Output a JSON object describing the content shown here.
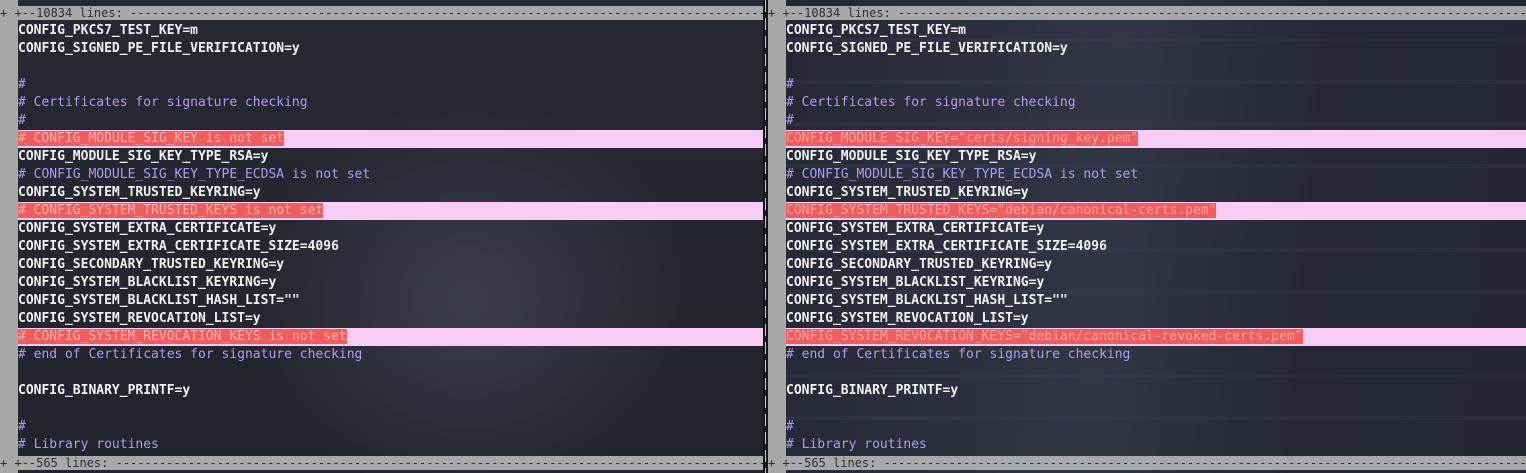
{
  "left_pane": {
    "fold_top": "+ +--10834 lines: ------------------------------------------------------------------------------------------",
    "fold_bottom": "+ +--565 lines: --------------------------------------------------------------------------------------------",
    "lines": [
      {
        "text": "CONFIG_PKCS7_TEST_KEY=m",
        "kind": "code"
      },
      {
        "text": "CONFIG_SIGNED_PE_FILE_VERIFICATION=y",
        "kind": "code"
      },
      {
        "text": "",
        "kind": "code"
      },
      {
        "text": "#",
        "kind": "comment"
      },
      {
        "text": "# Certificates for signature checking",
        "kind": "comment"
      },
      {
        "text": "#",
        "kind": "comment"
      },
      {
        "text": "# CONFIG_MODULE_SIG_KEY is not set",
        "kind": "diff"
      },
      {
        "text": "CONFIG_MODULE_SIG_KEY_TYPE_RSA=y",
        "kind": "code"
      },
      {
        "text": "# CONFIG_MODULE_SIG_KEY_TYPE_ECDSA is not set",
        "kind": "comment"
      },
      {
        "text": "CONFIG_SYSTEM_TRUSTED_KEYRING=y",
        "kind": "code"
      },
      {
        "text": "# CONFIG_SYSTEM_TRUSTED_KEYS is not set",
        "kind": "diff"
      },
      {
        "text": "CONFIG_SYSTEM_EXTRA_CERTIFICATE=y",
        "kind": "code"
      },
      {
        "text": "CONFIG_SYSTEM_EXTRA_CERTIFICATE_SIZE=4096",
        "kind": "code"
      },
      {
        "text": "CONFIG_SECONDARY_TRUSTED_KEYRING=y",
        "kind": "code"
      },
      {
        "text": "CONFIG_SYSTEM_BLACKLIST_KEYRING=y",
        "kind": "code"
      },
      {
        "text": "CONFIG_SYSTEM_BLACKLIST_HASH_LIST=\"\"",
        "kind": "code"
      },
      {
        "text": "CONFIG_SYSTEM_REVOCATION_LIST=y",
        "kind": "code"
      },
      {
        "text": "# CONFIG_SYSTEM_REVOCATION_KEYS is not set",
        "kind": "diff"
      },
      {
        "text": "# end of Certificates for signature checking",
        "kind": "comment"
      },
      {
        "text": "",
        "kind": "code"
      },
      {
        "text": "CONFIG_BINARY_PRINTF=y",
        "kind": "code"
      },
      {
        "text": "",
        "kind": "code"
      },
      {
        "text": "#",
        "kind": "comment"
      },
      {
        "text": "# Library routines",
        "kind": "comment"
      }
    ]
  },
  "right_pane": {
    "fold_top": "+ +--10834 lines: ------------------------------------------------------------------------------------------",
    "fold_bottom": "+ +--565 lines: --------------------------------------------------------------------------------------------",
    "lines": [
      {
        "text": "CONFIG_PKCS7_TEST_KEY=m",
        "kind": "code"
      },
      {
        "text": "CONFIG_SIGNED_PE_FILE_VERIFICATION=y",
        "kind": "code"
      },
      {
        "text": "",
        "kind": "code"
      },
      {
        "text": "#",
        "kind": "comment"
      },
      {
        "text": "# Certificates for signature checking",
        "kind": "comment"
      },
      {
        "text": "#",
        "kind": "comment"
      },
      {
        "text": "CONFIG_MODULE_SIG_KEY=\"certs/signing_key.pem\"",
        "kind": "diff"
      },
      {
        "text": "CONFIG_MODULE_SIG_KEY_TYPE_RSA=y",
        "kind": "code"
      },
      {
        "text": "# CONFIG_MODULE_SIG_KEY_TYPE_ECDSA is not set",
        "kind": "comment"
      },
      {
        "text": "CONFIG_SYSTEM_TRUSTED_KEYRING=y",
        "kind": "code"
      },
      {
        "text": "CONFIG_SYSTEM_TRUSTED_KEYS=\"debian/canonical-certs.pem\"",
        "kind": "diff"
      },
      {
        "text": "CONFIG_SYSTEM_EXTRA_CERTIFICATE=y",
        "kind": "code"
      },
      {
        "text": "CONFIG_SYSTEM_EXTRA_CERTIFICATE_SIZE=4096",
        "kind": "code"
      },
      {
        "text": "CONFIG_SECONDARY_TRUSTED_KEYRING=y",
        "kind": "code"
      },
      {
        "text": "CONFIG_SYSTEM_BLACKLIST_KEYRING=y",
        "kind": "code"
      },
      {
        "text": "CONFIG_SYSTEM_BLACKLIST_HASH_LIST=\"\"",
        "kind": "code"
      },
      {
        "text": "CONFIG_SYSTEM_REVOCATION_LIST=y",
        "kind": "code"
      },
      {
        "text": "CONFIG_SYSTEM_REVOCATION_KEYS=\"debian/canonical-revoked-certs.pem\"",
        "kind": "diff"
      },
      {
        "text": "# end of Certificates for signature checking",
        "kind": "comment"
      },
      {
        "text": "",
        "kind": "code"
      },
      {
        "text": "CONFIG_BINARY_PRINTF=y",
        "kind": "code"
      },
      {
        "text": "",
        "kind": "code"
      },
      {
        "text": "#",
        "kind": "comment"
      },
      {
        "text": "# Library routines",
        "kind": "comment"
      }
    ]
  },
  "colors": {
    "diff_line_bg": "#f9ccf6",
    "diff_text_bg": "#ef5d5d",
    "comment": "#b39af0",
    "code": "#f2f2f2",
    "fold_bg": "#a8a8a8"
  }
}
